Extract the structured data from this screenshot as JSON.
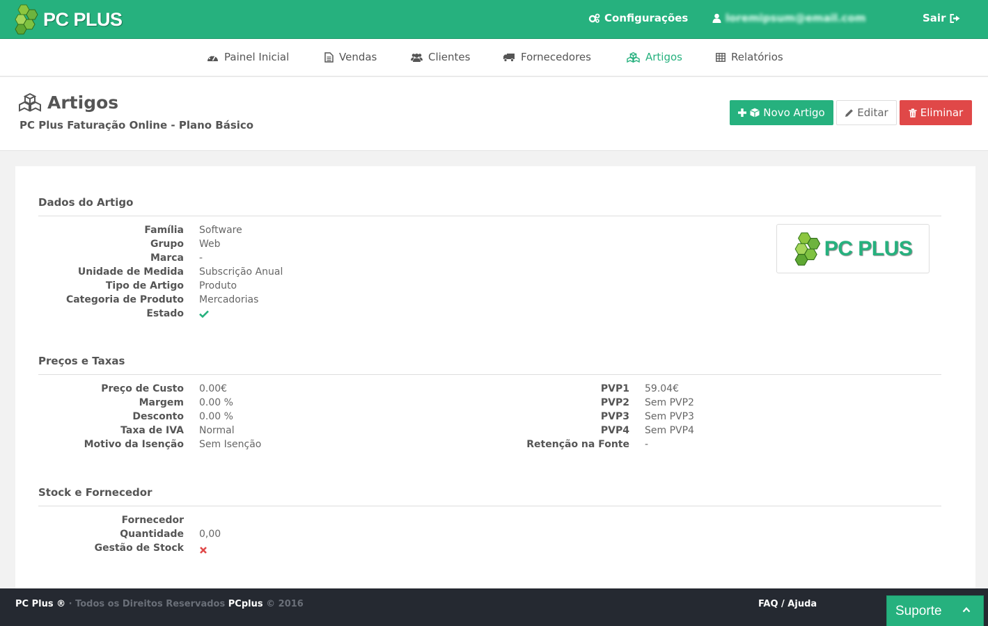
{
  "header": {
    "logo_text": "PC PLUS",
    "settings_label": "Configurações",
    "user_label": "loremipsum@email.com",
    "logout_label": "Sair"
  },
  "nav": {
    "items": [
      {
        "label": "Painel Inicial",
        "icon": "dashboard-icon"
      },
      {
        "label": "Vendas",
        "icon": "document-icon"
      },
      {
        "label": "Clientes",
        "icon": "users-icon"
      },
      {
        "label": "Fornecedores",
        "icon": "truck-icon"
      },
      {
        "label": "Artigos",
        "icon": "cubes-icon",
        "active": true
      },
      {
        "label": "Relatórios",
        "icon": "table-icon"
      }
    ]
  },
  "page": {
    "title": "Artigos",
    "subtitle": "PC Plus Faturação Online - Plano Básico",
    "buttons": {
      "new_label": "Novo Artigo",
      "edit_label": "Editar",
      "delete_label": "Eliminar"
    }
  },
  "sections": {
    "dados": {
      "title": "Dados do Artigo",
      "fields": [
        {
          "label": "Família",
          "value": "Software"
        },
        {
          "label": "Grupo",
          "value": "Web"
        },
        {
          "label": "Marca",
          "value": "-"
        },
        {
          "label": "Unidade de Medida",
          "value": "Subscrição Anual"
        },
        {
          "label": "Tipo de Artigo",
          "value": "Produto"
        },
        {
          "label": "Categoria de Produto",
          "value": "Mercadorias"
        },
        {
          "label": "Estado",
          "value": "",
          "icon": "check-icon"
        }
      ],
      "image_logo_text": "PC PLUS"
    },
    "precos": {
      "title": "Preços e Taxas",
      "left": [
        {
          "label": "Preço de Custo",
          "value": "0.00€"
        },
        {
          "label": "Margem",
          "value": "0.00 %"
        },
        {
          "label": "Desconto",
          "value": "0.00 %"
        },
        {
          "label": "Taxa de IVA",
          "value": "Normal"
        },
        {
          "label": "Motivo da Isenção",
          "value": "Sem Isenção"
        }
      ],
      "right": [
        {
          "label": "PVP1",
          "value": "59.04€"
        },
        {
          "label": "PVP2",
          "value": "Sem PVP2"
        },
        {
          "label": "PVP3",
          "value": "Sem PVP3"
        },
        {
          "label": "PVP4",
          "value": "Sem PVP4"
        },
        {
          "label": "Retenção na Fonte",
          "value": "-"
        }
      ]
    },
    "stock": {
      "title": "Stock e Fornecedor",
      "fields": [
        {
          "label": "Fornecedor",
          "value": ""
        },
        {
          "label": "Quantidade",
          "value": "0,00"
        },
        {
          "label": "Gestão de Stock",
          "value": "",
          "icon": "cross-icon"
        }
      ]
    }
  },
  "footer": {
    "brand": "PC Plus ®",
    "rights": "· Todos os Direitos Reservados",
    "company": "PCplus",
    "year": "© 2016",
    "faq_label": "FAQ / Ajuda",
    "support_label": "Suporte"
  },
  "colors": {
    "brand_green": "#26b17e",
    "danger_red": "#e04848",
    "footer_dark": "#252931"
  }
}
